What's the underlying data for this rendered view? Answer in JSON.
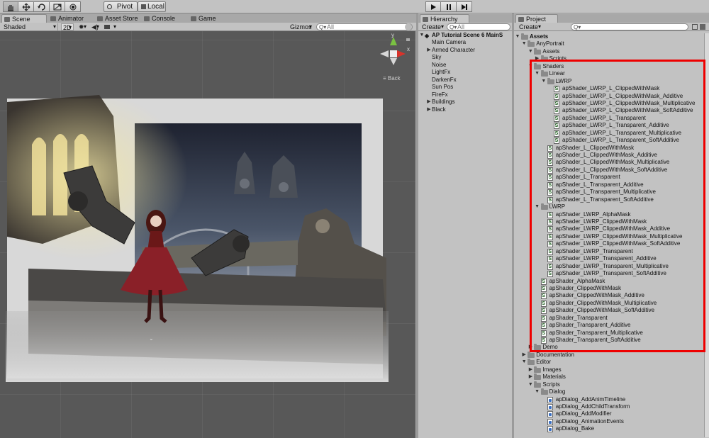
{
  "toolbar": {
    "tools": [
      {
        "name": "hand-tool",
        "icon": "hand-icon"
      },
      {
        "name": "move-tool",
        "icon": "move-icon"
      },
      {
        "name": "rotate-tool",
        "icon": "rotate-icon"
      },
      {
        "name": "scale-tool",
        "icon": "scale-icon"
      },
      {
        "name": "rect-tool",
        "icon": "rect-icon"
      }
    ],
    "pivot_label": "Pivot",
    "local_label": "Local",
    "play": [
      "play-icon",
      "pause-icon",
      "step-icon"
    ]
  },
  "scene_tabs": [
    {
      "label": "Scene",
      "active": true
    },
    {
      "label": "Animator",
      "active": false
    },
    {
      "label": "Asset Store",
      "active": false
    },
    {
      "label": "Console",
      "active": false
    },
    {
      "label": "Game",
      "active": false
    }
  ],
  "scene_toolbar": {
    "shading": "Shaded",
    "mode2d": "2D",
    "gizmos": "Gizmos",
    "search_placeholder": "All"
  },
  "gizmo": {
    "y_label": "y",
    "x_label": "x",
    "persp_label": "Back"
  },
  "hierarchy": {
    "tab": "Hierarchy",
    "create": "Create",
    "search_placeholder": "All",
    "scene_name": "AP Tutorial Scene 6 MainS",
    "items": [
      {
        "label": "Main Camera",
        "expandable": false
      },
      {
        "label": "Armed Character",
        "expandable": true
      },
      {
        "label": "Sky",
        "expandable": false
      },
      {
        "label": "Noise",
        "expandable": false
      },
      {
        "label": "LightFx",
        "expandable": false
      },
      {
        "label": "DarkenFx",
        "expandable": false
      },
      {
        "label": "Sun Pos",
        "expandable": false
      },
      {
        "label": "FireFx",
        "expandable": false
      },
      {
        "label": "Buildings",
        "expandable": true
      },
      {
        "label": "Black",
        "expandable": true
      }
    ]
  },
  "project": {
    "tab": "Project",
    "create": "Create",
    "search_placeholder": "",
    "tree": [
      {
        "label": "Assets",
        "depth": 0,
        "kind": "folder",
        "arrow": "open",
        "bold": true
      },
      {
        "label": "AnyPortrait",
        "depth": 1,
        "kind": "folder",
        "arrow": "open"
      },
      {
        "label": "Assets",
        "depth": 2,
        "kind": "folder",
        "arrow": "open"
      },
      {
        "label": "Scripts",
        "depth": 3,
        "kind": "folder",
        "arrow": "closed"
      },
      {
        "label": "Shaders",
        "depth": 2,
        "kind": "folder",
        "arrow": "open"
      },
      {
        "label": "Linear",
        "depth": 3,
        "kind": "folder",
        "arrow": "open"
      },
      {
        "label": "LWRP",
        "depth": 4,
        "kind": "folder",
        "arrow": "open"
      },
      {
        "label": "apShader_LWRP_L_ClippedWithMask",
        "depth": 5,
        "kind": "shader"
      },
      {
        "label": "apShader_LWRP_L_ClippedWithMask_Additive",
        "depth": 5,
        "kind": "shader"
      },
      {
        "label": "apShader_LWRP_L_ClippedWithMask_Multiplicative",
        "depth": 5,
        "kind": "shader"
      },
      {
        "label": "apShader_LWRP_L_ClippedWithMask_SoftAdditive",
        "depth": 5,
        "kind": "shader"
      },
      {
        "label": "apShader_LWRP_L_Transparent",
        "depth": 5,
        "kind": "shader"
      },
      {
        "label": "apShader_LWRP_L_Transparent_Additive",
        "depth": 5,
        "kind": "shader"
      },
      {
        "label": "apShader_LWRP_L_Transparent_Multiplicative",
        "depth": 5,
        "kind": "shader"
      },
      {
        "label": "apShader_LWRP_L_Transparent_SoftAdditive",
        "depth": 5,
        "kind": "shader"
      },
      {
        "label": "apShader_L_ClippedWithMask",
        "depth": 4,
        "kind": "shader"
      },
      {
        "label": "apShader_L_ClippedWithMask_Additive",
        "depth": 4,
        "kind": "shader"
      },
      {
        "label": "apShader_L_ClippedWithMask_Multiplicative",
        "depth": 4,
        "kind": "shader"
      },
      {
        "label": "apShader_L_ClippedWithMask_SoftAdditive",
        "depth": 4,
        "kind": "shader"
      },
      {
        "label": "apShader_L_Transparent",
        "depth": 4,
        "kind": "shader"
      },
      {
        "label": "apShader_L_Transparent_Additive",
        "depth": 4,
        "kind": "shader"
      },
      {
        "label": "apShader_L_Transparent_Multiplicative",
        "depth": 4,
        "kind": "shader"
      },
      {
        "label": "apShader_L_Transparent_SoftAdditive",
        "depth": 4,
        "kind": "shader"
      },
      {
        "label": "LWRP",
        "depth": 3,
        "kind": "folder",
        "arrow": "open"
      },
      {
        "label": "apShader_LWRP_AlphaMask",
        "depth": 4,
        "kind": "shader"
      },
      {
        "label": "apShader_LWRP_ClippedWithMask",
        "depth": 4,
        "kind": "shader"
      },
      {
        "label": "apShader_LWRP_ClippedWithMask_Additive",
        "depth": 4,
        "kind": "shader"
      },
      {
        "label": "apShader_LWRP_ClippedWithMask_Multiplicative",
        "depth": 4,
        "kind": "shader"
      },
      {
        "label": "apShader_LWRP_ClippedWithMask_SoftAdditive",
        "depth": 4,
        "kind": "shader"
      },
      {
        "label": "apShader_LWRP_Transparent",
        "depth": 4,
        "kind": "shader"
      },
      {
        "label": "apShader_LWRP_Transparent_Additive",
        "depth": 4,
        "kind": "shader"
      },
      {
        "label": "apShader_LWRP_Transparent_Multiplicative",
        "depth": 4,
        "kind": "shader"
      },
      {
        "label": "apShader_LWRP_Transparent_SoftAdditive",
        "depth": 4,
        "kind": "shader"
      },
      {
        "label": "apShader_AlphaMask",
        "depth": 3,
        "kind": "shader"
      },
      {
        "label": "apShader_ClippedWithMask",
        "depth": 3,
        "kind": "shader"
      },
      {
        "label": "apShader_ClippedWithMask_Additive",
        "depth": 3,
        "kind": "shader"
      },
      {
        "label": "apShader_ClippedWithMask_Multiplicative",
        "depth": 3,
        "kind": "shader"
      },
      {
        "label": "apShader_ClippedWithMask_SoftAdditive",
        "depth": 3,
        "kind": "shader"
      },
      {
        "label": "apShader_Transparent",
        "depth": 3,
        "kind": "shader"
      },
      {
        "label": "apShader_Transparent_Additive",
        "depth": 3,
        "kind": "shader"
      },
      {
        "label": "apShader_Transparent_Multiplicative",
        "depth": 3,
        "kind": "shader"
      },
      {
        "label": "apShader_Transparent_SoftAdditive",
        "depth": 3,
        "kind": "shader"
      },
      {
        "label": "Demo",
        "depth": 2,
        "kind": "folder",
        "arrow": "closed"
      },
      {
        "label": "Documentation",
        "depth": 1,
        "kind": "folder",
        "arrow": "closed"
      },
      {
        "label": "Editor",
        "depth": 1,
        "kind": "folder",
        "arrow": "open"
      },
      {
        "label": "Images",
        "depth": 2,
        "kind": "folder",
        "arrow": "closed"
      },
      {
        "label": "Materials",
        "depth": 2,
        "kind": "folder",
        "arrow": "closed"
      },
      {
        "label": "Scripts",
        "depth": 2,
        "kind": "folder",
        "arrow": "open"
      },
      {
        "label": "Dialog",
        "depth": 3,
        "kind": "folder",
        "arrow": "open"
      },
      {
        "label": "apDialog_AddAnimTimeline",
        "depth": 4,
        "kind": "cs"
      },
      {
        "label": "apDialog_AddChildTransform",
        "depth": 4,
        "kind": "cs"
      },
      {
        "label": "apDialog_AddModifier",
        "depth": 4,
        "kind": "cs"
      },
      {
        "label": "apDialog_AnimationEvents",
        "depth": 4,
        "kind": "cs"
      },
      {
        "label": "apDialog_Bake",
        "depth": 4,
        "kind": "cs"
      }
    ]
  },
  "colors": {
    "highlight": "#ee0000",
    "scene_bg": "#585858",
    "panel_bg": "#c2c2c2"
  }
}
